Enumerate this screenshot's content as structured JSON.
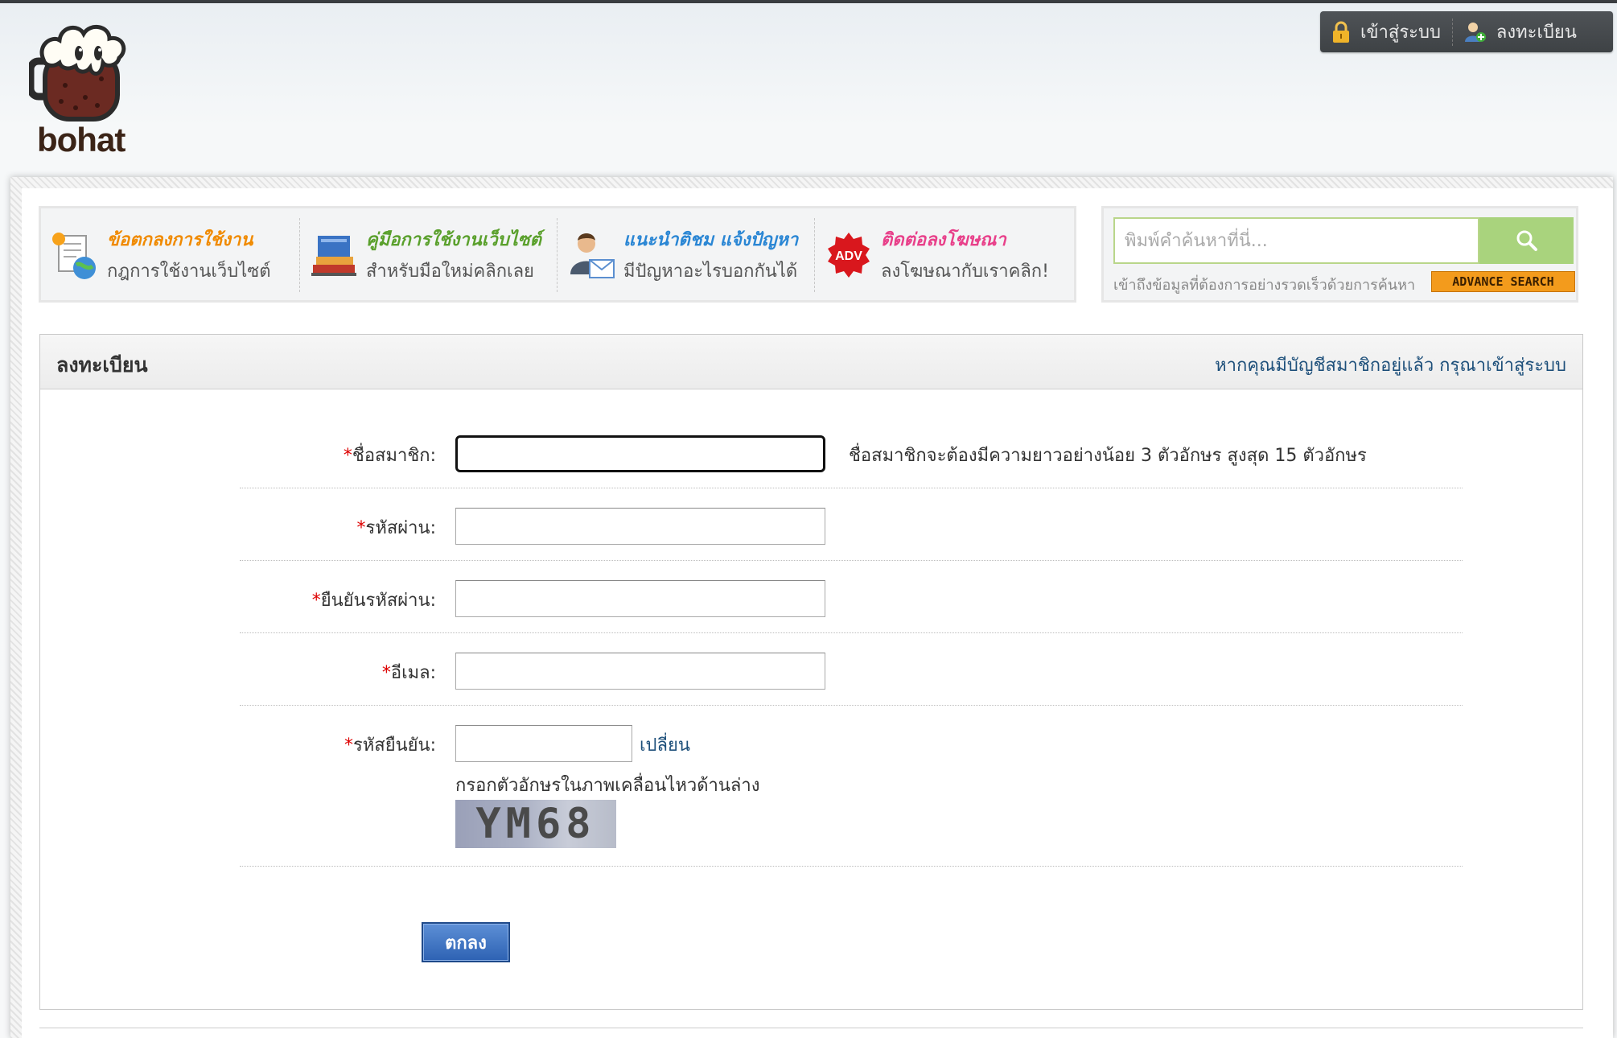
{
  "brand": {
    "logo_text": "bohat"
  },
  "userbar": {
    "login": "เข้าสู่ระบบ",
    "register": "ลงทะเบียน"
  },
  "nav": [
    {
      "title": "ข้อตกลงการใช้งาน",
      "subtitle": "กฎการใช้งานเว็บไซต์",
      "color": "#f08a00",
      "icon": "document-globe-icon"
    },
    {
      "title": "คู่มือการใช้งานเว็บไซต์",
      "subtitle": "สำหรับมือใหม่คลิกเลย",
      "color": "#5aa02c",
      "icon": "books-icon"
    },
    {
      "title": "แนะนำติชม แจ้งปัญหา",
      "subtitle": "มีปัญหาอะไรบอกกันได้",
      "color": "#2a86d4",
      "icon": "support-mail-icon"
    },
    {
      "title": "ติดต่อลงโฆษณา",
      "subtitle": "ลงโฆษณากับเราคลิก!",
      "color": "#e8408a",
      "icon": "adv-badge-icon",
      "badge": "ADV"
    }
  ],
  "search": {
    "placeholder": "พิมพ์คำค้นหาที่นี่...",
    "help": "เข้าถึงข้อมูลที่ต้องการอย่างรวดเร็วด้วยการค้นหา",
    "advance": "ADVANCE SEARCH"
  },
  "register": {
    "title": "ลงทะเบียน",
    "login_link": "หากคุณมีบัญชีสมาชิกอยู่แล้ว กรุณาเข้าสู่ระบบ",
    "required_mark": "*",
    "username_label": "ชื่อสมาชิก:",
    "username_hint": "ชื่อสมาชิกจะต้องมีความยาวอย่างน้อย 3 ตัวอักษร สูงสุด 15 ตัวอักษร",
    "password_label": "รหัสผ่าน:",
    "confirm_label": "ยืนยันรหัสผ่าน:",
    "email_label": "อีเมล:",
    "captcha_label": "รหัสยืนยัน:",
    "captcha_change": "เปลี่ยน",
    "captcha_hint": "กรอกตัวอักษรในภาพเคลื่อนไหวด้านล่าง",
    "captcha_code": "YM68",
    "submit": "ตกลง"
  }
}
